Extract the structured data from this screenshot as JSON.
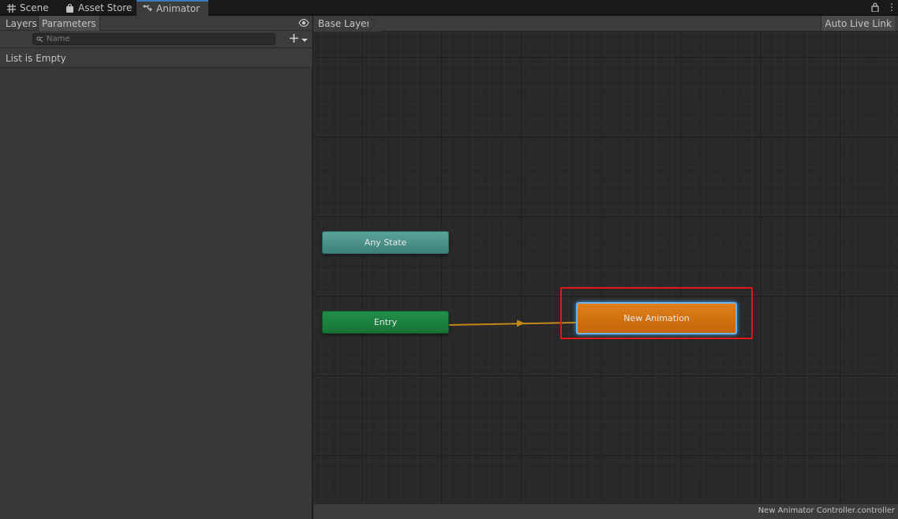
{
  "window_tabs": [
    {
      "label": "Scene",
      "icon": "grid-icon"
    },
    {
      "label": "Asset Store",
      "icon": "shopping-bag-icon"
    },
    {
      "label": "Animator",
      "icon": "animator-icon",
      "active": true
    }
  ],
  "left_panel": {
    "tabs": [
      "Layers",
      "Parameters"
    ],
    "active_tab": "Parameters",
    "search_placeholder": "Name",
    "empty_text": "List is Empty"
  },
  "graph": {
    "breadcrumb": "Base Layer",
    "auto_live_link": "Auto Live Link",
    "nodes": {
      "any_state": "Any State",
      "entry": "Entry",
      "new_animation": "New Animation"
    },
    "controller_name": "New Animator Controller.controller"
  },
  "colors": {
    "accent": "#3a79bb",
    "any_state": "#4b948b",
    "entry": "#1b8040",
    "default_state": "#d3710f",
    "selection": "#6fb4f0",
    "highlight": "#e01818",
    "transition": "#c58a16"
  }
}
